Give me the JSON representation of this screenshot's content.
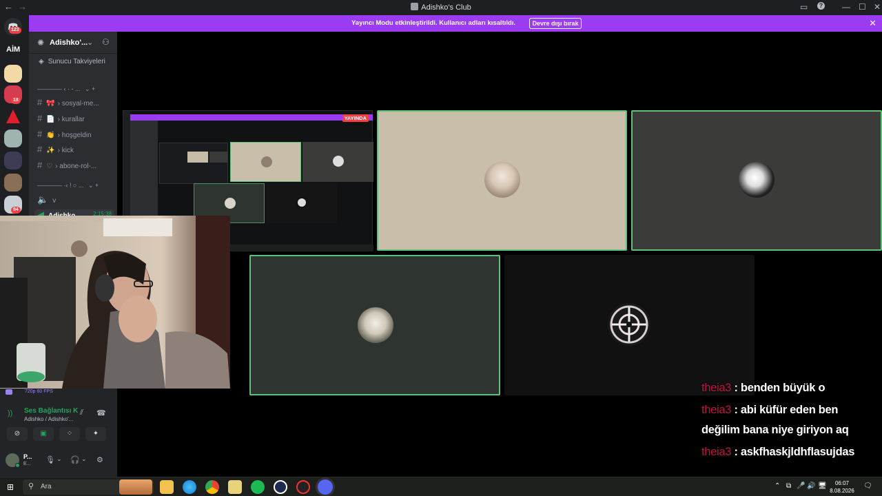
{
  "window": {
    "title": "Adishko's Club",
    "back_icon": "arrow-left",
    "forward_icon": "arrow-right",
    "controls": [
      "inbox-icon",
      "help-icon",
      "minimize",
      "maximize",
      "close"
    ]
  },
  "banner": {
    "message": "Yayıncı Modu etkinleştirildi. Kullanıcı adları kısaltıldı.",
    "button": "Devre dışı bırak",
    "close_icon": "✕"
  },
  "server_rail": {
    "home_badge": "123",
    "aim_label": "AİM",
    "badges": [
      "18",
      "84"
    ]
  },
  "sidebar": {
    "server_name": "Adishko'...",
    "boost_label": "Sunucu Takviyeleri",
    "category1": "———— ‹ · - ...",
    "category2": "———— ·‹ ! ○ ...",
    "channels": [
      {
        "emoji": "🎀",
        "label": "› sosyal-me..."
      },
      {
        "emoji": "📄",
        "label": "› kurallar"
      },
      {
        "emoji": "👏",
        "label": "› hoşgeldin"
      },
      {
        "emoji": "✨",
        "label": "› kick"
      },
      {
        "emoji": "♡",
        "label": "› abone-rol-..."
      }
    ],
    "voice_channel": "v",
    "live_user": "Adishko",
    "live_time": "2:15:38"
  },
  "stream_overlay": {
    "live_badge": "YAYINDA",
    "quality": "720p 60 FPS"
  },
  "voice_panel": {
    "title": "Ses Bağlantısı K",
    "subtitle": "Adishko / Adishko'..."
  },
  "user_panel": {
    "name": "P...",
    "status": "E..."
  },
  "chat": [
    {
      "nick": "theia3",
      "text": " : benden büyük o"
    },
    {
      "nick": "theia3",
      "text": " : abi küfür eden ben değilim bana niye giriyon aq"
    },
    {
      "nick": "theia3",
      "text": " : askfhaskjldhflasujdas"
    }
  ],
  "taskbar": {
    "search_placeholder": "Ara",
    "time": "06:07",
    "date": "8.08.2026"
  }
}
